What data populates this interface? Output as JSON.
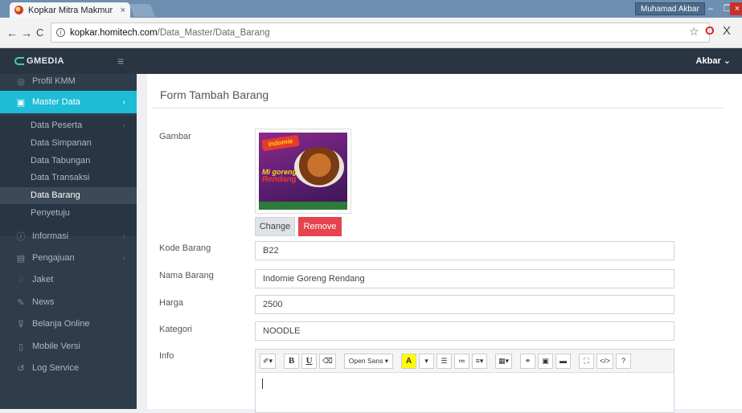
{
  "browser": {
    "tab_title": "Kopkar Mitra Makmur",
    "tab_close": "×",
    "user_chip": "Muhamad Akbar",
    "win_min": "–",
    "win_max": "❐",
    "win_close": "×",
    "url_host": "kopkar.homitech.com",
    "url_path": "/Data_Master/Data_Barang",
    "back": "←",
    "forward": "→",
    "reload": "C",
    "star": "☆",
    "opera": "O",
    "ext": "X"
  },
  "header": {
    "logo": "GMEDIA",
    "hamburger": "≡",
    "account": "Akbar ⌄"
  },
  "sidebar": {
    "items": [
      {
        "label": "Profil KMM",
        "icon": "◎"
      },
      {
        "label": "Master Data",
        "icon": "▣",
        "chev": "‹"
      },
      {
        "label": "Informasi",
        "icon": "ⓘ",
        "chev": "‹"
      },
      {
        "label": "Pengajuan",
        "icon": "▤",
        "chev": "‹"
      },
      {
        "label": "Jaket",
        "icon": "◌"
      },
      {
        "label": "News",
        "icon": "✎"
      },
      {
        "label": "Belanja Online",
        "icon": "⊽"
      },
      {
        "label": "Mobile Versi",
        "icon": "▯"
      },
      {
        "label": "Log Service",
        "icon": "↺"
      }
    ],
    "submenu": [
      {
        "label": "Data Peserta",
        "chev": "‹"
      },
      {
        "label": "Data Simpanan"
      },
      {
        "label": "Data Tabungan"
      },
      {
        "label": "Data Transaksi"
      },
      {
        "label": "Data Barang"
      },
      {
        "label": "Penyetuju"
      }
    ]
  },
  "form": {
    "title": "Form Tambah Barang",
    "labels": {
      "gambar": "Gambar",
      "kode": "Kode Barang",
      "nama": "Nama Barang",
      "harga": "Harga",
      "kategori": "Kategori",
      "info": "Info"
    },
    "values": {
      "kode": "B22",
      "nama": "Indomie Goreng Rendang",
      "harga": "2500",
      "kategori": "NOODLE"
    },
    "image_buttons": {
      "change": "Change",
      "remove": "Remove"
    },
    "product_image": {
      "brand": "Indomie",
      "line1": "Mi goreng",
      "line2": "Rendang"
    }
  },
  "editor": {
    "tools": {
      "style": "✐▾",
      "bold": "B",
      "underline": "U",
      "eraser": "⌫",
      "font": "Open Sans ▾",
      "color": "A",
      "color_arrow": "▾",
      "ul": "☰",
      "ol": "≔",
      "align": "≡▾",
      "table": "▦▾",
      "link": "⚭",
      "picture": "▣",
      "video": "▬",
      "fullscreen": "⛶",
      "code": "</>",
      "help": "?"
    }
  }
}
